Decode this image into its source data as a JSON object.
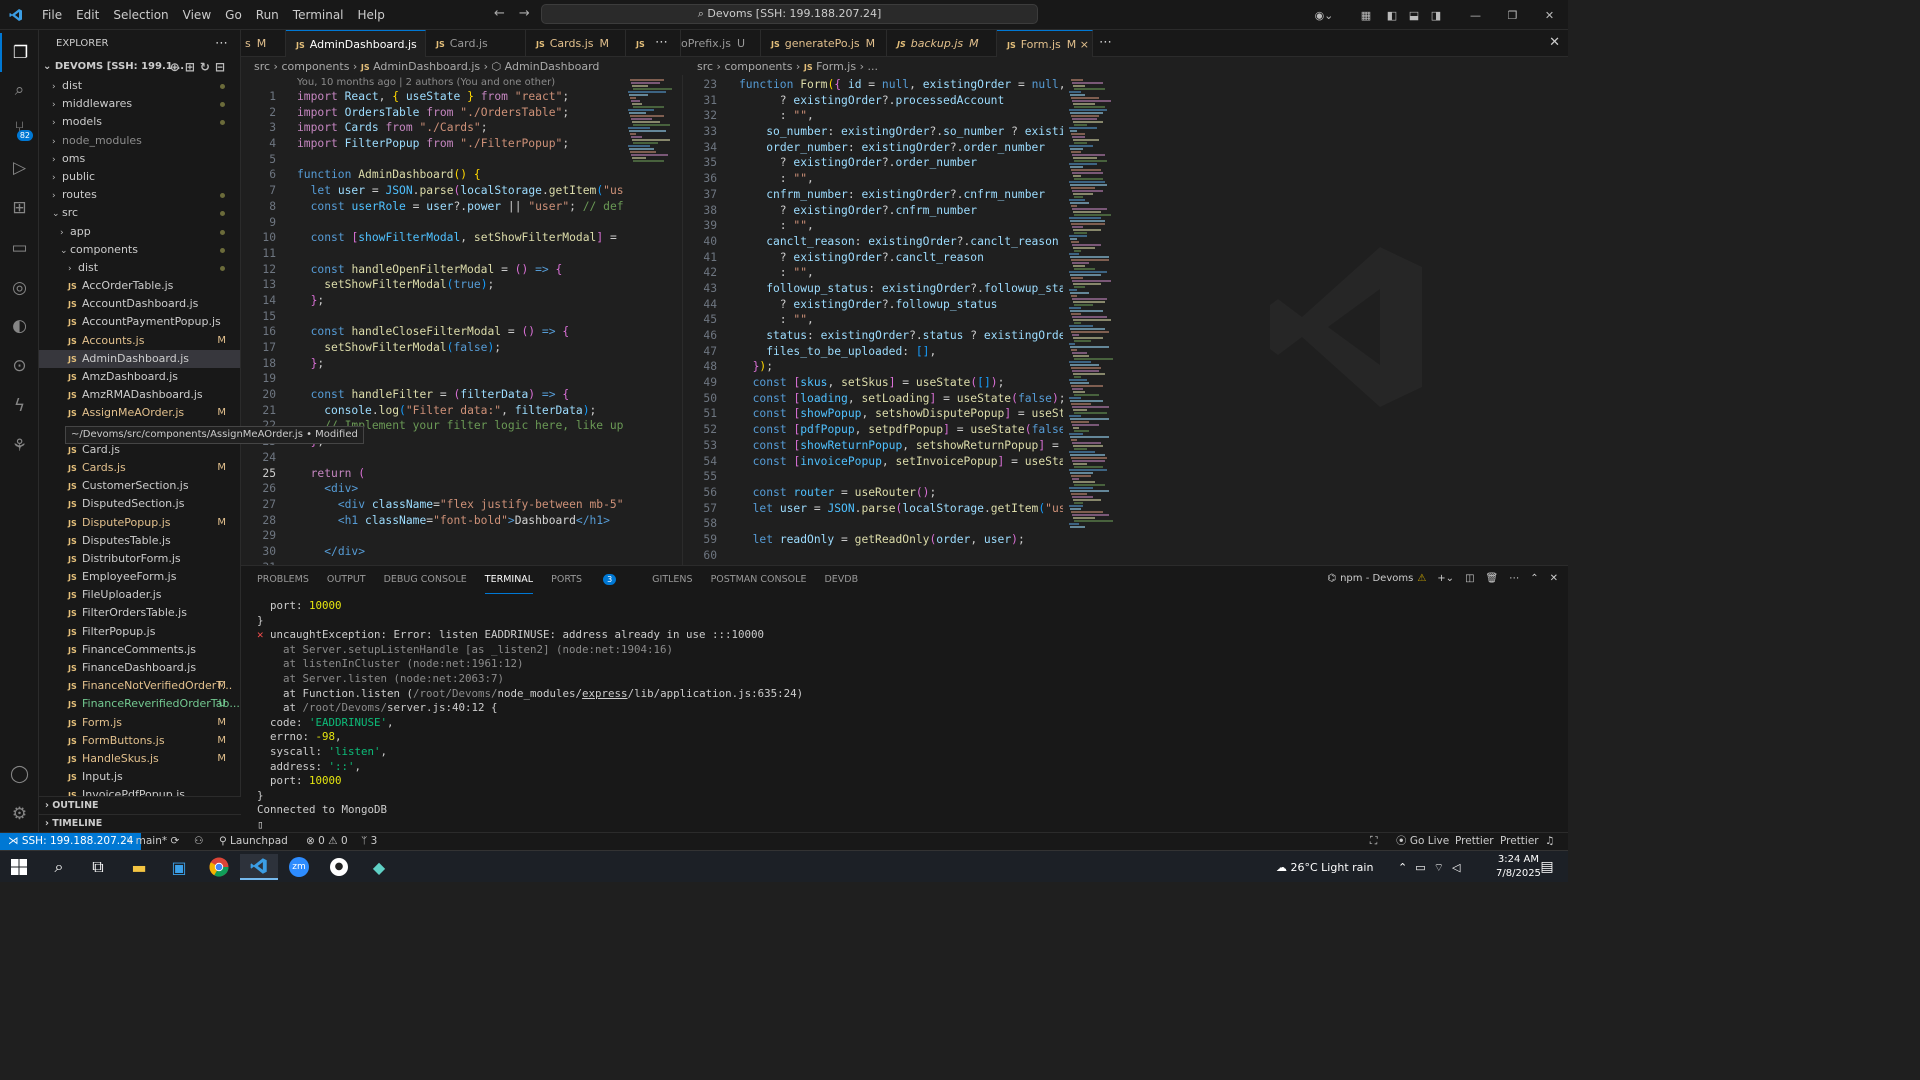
{
  "menu": [
    "File",
    "Edit",
    "Selection",
    "View",
    "Go",
    "Run",
    "Terminal",
    "Help"
  ],
  "command_center": "Devoms [SSH: 199.188.207.24]",
  "explorer": {
    "title": "EXPLORER",
    "root": "DEVOMS [SSH: 199.1...",
    "items": [
      {
        "label": "dist",
        "type": "folder",
        "depth": 0,
        "status": "dot"
      },
      {
        "label": "middlewares",
        "type": "folder",
        "depth": 0,
        "status": "dot"
      },
      {
        "label": "models",
        "type": "folder",
        "depth": 0,
        "status": "dot"
      },
      {
        "label": "node_modules",
        "type": "folder",
        "depth": 0,
        "status": "ignored"
      },
      {
        "label": "oms",
        "type": "folder",
        "depth": 0,
        "status": ""
      },
      {
        "label": "public",
        "type": "folder",
        "depth": 0,
        "status": ""
      },
      {
        "label": "routes",
        "type": "folder",
        "depth": 0,
        "status": "dot"
      },
      {
        "label": "src",
        "type": "folder-open",
        "depth": 0,
        "status": "dot"
      },
      {
        "label": "app",
        "type": "folder",
        "depth": 1,
        "status": "dot"
      },
      {
        "label": "components",
        "type": "folder-open",
        "depth": 1,
        "status": "dot"
      },
      {
        "label": "dist",
        "type": "folder",
        "depth": 2,
        "status": "dot"
      },
      {
        "label": "AccOrderTable.js",
        "type": "js",
        "depth": 2,
        "status": ""
      },
      {
        "label": "AccountDashboard.js",
        "type": "js",
        "depth": 2,
        "status": ""
      },
      {
        "label": "AccountPaymentPopup.js",
        "type": "js",
        "depth": 2,
        "status": ""
      },
      {
        "label": "Accounts.js",
        "type": "js",
        "depth": 2,
        "status": "M"
      },
      {
        "label": "AdminDashboard.js",
        "type": "js",
        "depth": 2,
        "status": "",
        "selected": true
      },
      {
        "label": "AmzDashboard.js",
        "type": "js",
        "depth": 2,
        "status": ""
      },
      {
        "label": "AmzRMADashboard.js",
        "type": "js",
        "depth": 2,
        "status": ""
      },
      {
        "label": "AssignMeAOrder.js",
        "type": "js",
        "depth": 2,
        "status": "M"
      },
      {
        "label": "",
        "type": "js",
        "depth": 2,
        "status": ""
      },
      {
        "label": "Card.js",
        "type": "js",
        "depth": 2,
        "status": ""
      },
      {
        "label": "Cards.js",
        "type": "js",
        "depth": 2,
        "status": "M"
      },
      {
        "label": "CustomerSection.js",
        "type": "js",
        "depth": 2,
        "status": ""
      },
      {
        "label": "DisputedSection.js",
        "type": "js",
        "depth": 2,
        "status": ""
      },
      {
        "label": "DisputePopup.js",
        "type": "js",
        "depth": 2,
        "status": "M"
      },
      {
        "label": "DisputesTable.js",
        "type": "js",
        "depth": 2,
        "status": ""
      },
      {
        "label": "DistributorForm.js",
        "type": "js",
        "depth": 2,
        "status": ""
      },
      {
        "label": "EmployeeForm.js",
        "type": "js",
        "depth": 2,
        "status": ""
      },
      {
        "label": "FileUploader.js",
        "type": "js",
        "depth": 2,
        "status": ""
      },
      {
        "label": "FilterOrdersTable.js",
        "type": "js",
        "depth": 2,
        "status": ""
      },
      {
        "label": "FilterPopup.js",
        "type": "js",
        "depth": 2,
        "status": ""
      },
      {
        "label": "FinanceComments.js",
        "type": "js",
        "depth": 2,
        "status": ""
      },
      {
        "label": "FinanceDashboard.js",
        "type": "js",
        "depth": 2,
        "status": ""
      },
      {
        "label": "FinanceNotVerifiedOrderT...",
        "type": "js",
        "depth": 2,
        "status": "M"
      },
      {
        "label": "FinanceReverifiedOrderTab...",
        "type": "js",
        "depth": 2,
        "status": "U"
      },
      {
        "label": "Form.js",
        "type": "js",
        "depth": 2,
        "status": "M"
      },
      {
        "label": "FormButtons.js",
        "type": "js",
        "depth": 2,
        "status": "M"
      },
      {
        "label": "HandleSkus.js",
        "type": "js",
        "depth": 2,
        "status": "M"
      },
      {
        "label": "Input.js",
        "type": "js",
        "depth": 2,
        "status": ""
      },
      {
        "label": "InvoicePdfPopup.js",
        "type": "js",
        "depth": 2,
        "status": ""
      }
    ],
    "tooltip": "~/Devoms/src/components/AssignMeAOrder.js • Modified",
    "outline": "OUTLINE",
    "timeline": "TIMELINE"
  },
  "tabs_left": [
    {
      "label": "s",
      "status": "M"
    },
    {
      "label": "AdminDashboard.js",
      "status": "×",
      "active": true
    },
    {
      "label": "Card.js",
      "status": ""
    },
    {
      "label": "Cards.js",
      "status": "M"
    },
    {
      "label": "",
      "status": ""
    }
  ],
  "tabs_right": [
    {
      "label": "oPrefix.js",
      "status": "U"
    },
    {
      "label": "generatePo.js",
      "status": "M"
    },
    {
      "label": "backup.js",
      "status": "M"
    },
    {
      "label": "Form.js",
      "status": "M ×",
      "active": true
    }
  ],
  "breadcrumb_left": [
    "src",
    "components",
    "AdminDashboard.js",
    "AdminDashboard"
  ],
  "breadcrumb_right": [
    "src",
    "components",
    "Form.js",
    "..."
  ],
  "blame": "You, 10 months ago | 2 authors (You and one other)",
  "left_line_numbers": [
    "1",
    "2",
    "3",
    "4",
    "5",
    "6",
    "7",
    "8",
    "9",
    "10",
    "11",
    "12",
    "13",
    "14",
    "15",
    "16",
    "17",
    "18",
    "19",
    "20",
    "21",
    "22",
    "23",
    "24",
    "25",
    "26",
    "27",
    "28",
    "29",
    "30",
    "31"
  ],
  "right_line_numbers": [
    "23",
    "31",
    "32",
    "33",
    "34",
    "35",
    "36",
    "37",
    "38",
    "39",
    "40",
    "41",
    "42",
    "43",
    "44",
    "45",
    "46",
    "47",
    "48",
    "49",
    "50",
    "51",
    "52",
    "53",
    "54",
    "55",
    "56",
    "57",
    "58",
    "59",
    "60"
  ],
  "panel": {
    "tabs": [
      "PROBLEMS",
      "OUTPUT",
      "DEBUG CONSOLE",
      "TERMINAL",
      "PORTS",
      "GITLENS",
      "POSTMAN CONSOLE",
      "DEVDB"
    ],
    "ports_badge": "3",
    "terminal_name": "npm - Devoms",
    "lines": [
      "  port: 10000",
      "}",
      "✕ uncaughtException: Error: listen EADDRINUSE: address already in use :::10000",
      "    at Server.setupListenHandle [as _listen2] (node:net:1904:16)",
      "    at listenInCluster (node:net:1961:12)",
      "    at Server.listen (node:net:2063:7)",
      "    at Function.listen (/root/Devoms/node_modules/express/lib/application.js:635:24)",
      "    at /root/Devoms/server.js:40:12 {",
      "  code: 'EADDRINUSE',",
      "  errno: -98,",
      "  syscall: 'listen',",
      "  address: '::',",
      "  port: 10000",
      "}",
      "Connected to MongoDB",
      "▯"
    ]
  },
  "status": {
    "remote": "SSH: 199.188.207.24",
    "branch": "main*",
    "launchpad": "Launchpad",
    "errors": "0",
    "warnings": "0",
    "ports": "3",
    "go_live": "Go Live",
    "prettier1": "Prettier",
    "prettier2": "Prettier"
  },
  "taskbar": {
    "weather": "26°C  Light rain",
    "time": "3:24 AM",
    "date": "7/8/2025"
  }
}
